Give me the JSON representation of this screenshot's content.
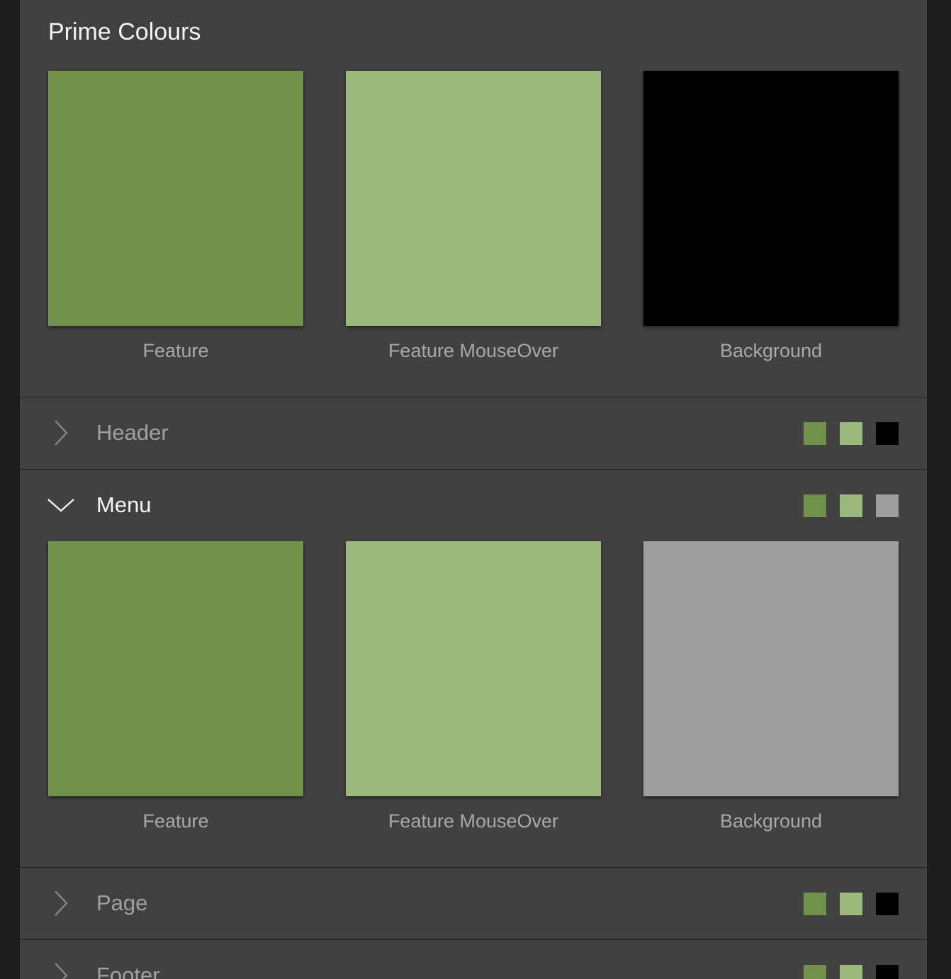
{
  "prime": {
    "title": "Prime Colours",
    "swatches": [
      {
        "label": "Feature",
        "color": "#71924b"
      },
      {
        "label": "Feature MouseOver",
        "color": "#9cb97c"
      },
      {
        "label": "Background",
        "color": "#000000"
      }
    ]
  },
  "sections": [
    {
      "label": "Header",
      "expanded": false,
      "colors": [
        "#71924b",
        "#9cb97c",
        "#000000"
      ]
    },
    {
      "label": "Menu",
      "expanded": true,
      "colors": [
        "#71924b",
        "#9cb97c",
        "#9e9e9e"
      ],
      "swatches": [
        {
          "label": "Feature",
          "color": "#71924b"
        },
        {
          "label": "Feature MouseOver",
          "color": "#9cb97c"
        },
        {
          "label": "Background",
          "color": "#9e9e9e"
        }
      ]
    },
    {
      "label": "Page",
      "expanded": false,
      "colors": [
        "#71924b",
        "#9cb97c",
        "#000000"
      ]
    },
    {
      "label": "Footer",
      "expanded": false,
      "colors": [
        "#71924b",
        "#9cb97c",
        "#000000"
      ]
    }
  ],
  "icons": {
    "collapsed": "chevron-right-icon",
    "expanded": "chevron-down-icon"
  }
}
